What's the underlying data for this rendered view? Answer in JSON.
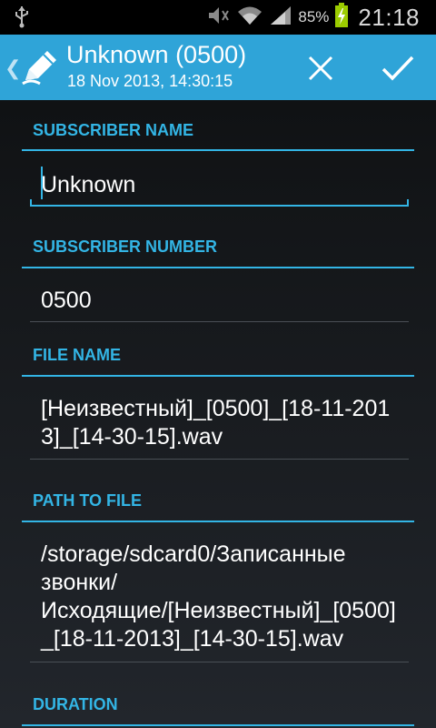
{
  "status_bar": {
    "battery_percent": "85%",
    "time": "21:18",
    "icons": [
      "usb-icon",
      "mute-icon",
      "wifi-icon",
      "signal-icon",
      "battery-charging-icon"
    ]
  },
  "action_bar": {
    "title": "Unknown (0500)",
    "subtitle": "18 Nov 2013, 14:30:15",
    "icons": [
      "back-caret-icon",
      "pencil-icon",
      "close-icon",
      "check-icon"
    ]
  },
  "form": {
    "subscriber_name": {
      "label": "SUBSCRIBER NAME",
      "value": "Unknown"
    },
    "subscriber_number": {
      "label": "SUBSCRIBER NUMBER",
      "value": "0500"
    },
    "file_name": {
      "label": "FILE NAME",
      "value": "[Неизвестный]_[0500]_[18-11-2013]_[14-30-15].wav"
    },
    "path_to_file": {
      "label": "PATH TO FILE",
      "value": "/storage/sdcard0/Записанные звонки/Исходящие/[Неизвестный]_[0500]_[18-11-2013]_[14-30-15].wav"
    },
    "duration": {
      "label": "DURATION"
    }
  },
  "colors": {
    "accent": "#33b5e5",
    "action_bar": "#2fa4d8"
  }
}
